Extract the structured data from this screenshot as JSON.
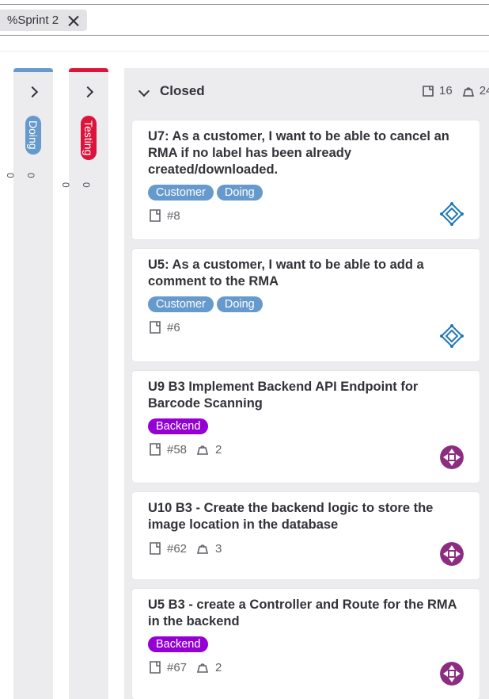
{
  "filter": {
    "token": "%Sprint 2"
  },
  "lists": {
    "doing": {
      "label": "Doing",
      "color": "#6699cc",
      "issues": "0",
      "weight": "0"
    },
    "testing": {
      "label": "Testing",
      "color": "#dc143c",
      "issues": "0",
      "weight": "0"
    },
    "closed": {
      "title": "Closed",
      "issues": "16",
      "weight": "24"
    }
  },
  "colors": {
    "customer": "#6699cc",
    "doing": "#6699cc",
    "backend": "#9400d3"
  },
  "cards": [
    {
      "title": "U7: As a customer, I want to be able to cancel an RMA if no label has been already created/downloaded.",
      "labels": [
        "Customer",
        "Doing"
      ],
      "ref": "#8",
      "weight": ""
    },
    {
      "title": "U5: As a customer, I want to be able to add a comment to the RMA",
      "labels": [
        "Customer",
        "Doing"
      ],
      "ref": "#6",
      "weight": ""
    },
    {
      "title": "U9 B3 Implement Backend API Endpoint for Barcode Scanning",
      "labels": [
        "Backend"
      ],
      "ref": "#58",
      "weight": "2"
    },
    {
      "title": "U10 B3 - Create the backend logic to store the image location in the database",
      "labels": [],
      "ref": "#62",
      "weight": "3"
    },
    {
      "title": "U5 B3 - create a Controller and Route for the RMA in the backend",
      "labels": [
        "Backend"
      ],
      "ref": "#67",
      "weight": "2"
    }
  ]
}
